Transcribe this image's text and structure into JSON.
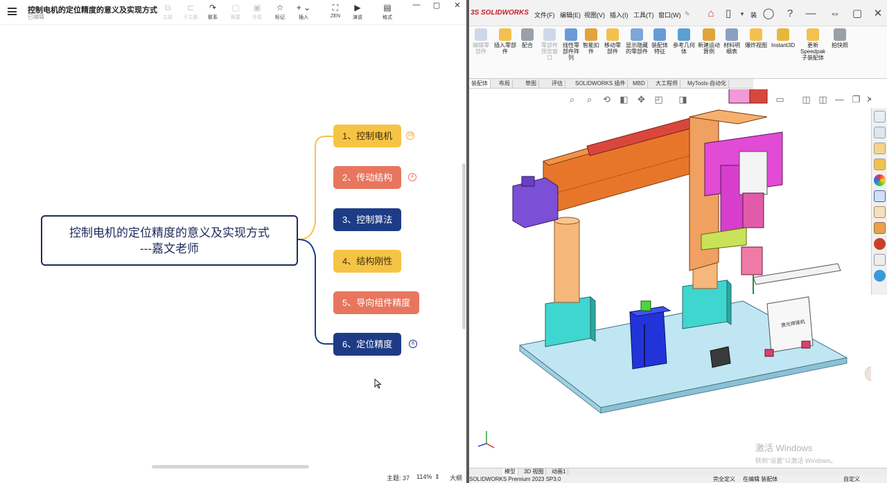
{
  "mindmap": {
    "title": "控制电机的定位精度的意义及实现方式",
    "subtitle": "已编辑",
    "toolbar": [
      {
        "icon": "⧉",
        "label": "主题",
        "disabled": true
      },
      {
        "icon": "⊏",
        "label": "子主题",
        "disabled": true
      },
      {
        "icon": "↷",
        "label": "联系",
        "disabled": false
      },
      {
        "icon": "▢",
        "label": "概要",
        "disabled": true
      },
      {
        "icon": "▣",
        "label": "外框",
        "disabled": true
      },
      {
        "icon": "☆",
        "label": "标记",
        "disabled": false
      },
      {
        "icon": "+ ⌄",
        "label": "插入",
        "disabled": false
      },
      {
        "icon": "⛶",
        "label": "ZEN",
        "disabled": false
      },
      {
        "icon": "▶",
        "label": "演说",
        "disabled": false
      },
      {
        "icon": "▤",
        "label": "格式",
        "disabled": false
      }
    ],
    "window_controls": [
      "—",
      "▢",
      "✕"
    ],
    "central_topic": {
      "line1": "控制电机的定位精度的意义及实现方式",
      "line2": "---嘉文老师"
    },
    "topics": [
      {
        "label": "1、控制电机",
        "color": "yellow",
        "badge": "19"
      },
      {
        "label": "2、传动结构",
        "color": "salmon",
        "badge": "4"
      },
      {
        "label": "3、控制算法",
        "color": "navy",
        "badge": ""
      },
      {
        "label": "4、结构刚性",
        "color": "yellow",
        "badge": ""
      },
      {
        "label": "5、导向组件精度",
        "color": "salmon",
        "badge": ""
      },
      {
        "label": "6、定位精度",
        "color": "navy",
        "badge": "8"
      }
    ],
    "status": {
      "topic_count": "主题: 37",
      "zoom": "114%",
      "outline": "大纲"
    }
  },
  "solidworks": {
    "logo": "3S SOLIDWORKS",
    "menu": [
      "文件(F)",
      "编辑(E)",
      "视图(V)",
      "插入(I)",
      "工具(T)",
      "窗口(W)"
    ],
    "doc_label": "装",
    "ribbon": [
      {
        "label": "编辑零部件",
        "disabled": true,
        "color": "#cfd8e8"
      },
      {
        "label": "插入零部件",
        "disabled": false,
        "color": "#f2c14e"
      },
      {
        "label": "配合",
        "disabled": false,
        "color": "#9aa0a8"
      },
      {
        "label": "零部件预览窗口",
        "disabled": true,
        "color": "#cfd8e8"
      },
      {
        "label": "线性零部件阵列",
        "disabled": false,
        "color": "#6a9bd8"
      },
      {
        "label": "智能扣件",
        "disabled": false,
        "color": "#e0a43c"
      },
      {
        "label": "移动零部件",
        "disabled": false,
        "color": "#f2c14e"
      },
      {
        "label": "显示隐藏的零部件",
        "disabled": false,
        "color": "#7da7d9"
      },
      {
        "label": "装配体特征",
        "disabled": false,
        "color": "#6a9bd8"
      },
      {
        "label": "参考几何体",
        "disabled": false,
        "color": "#5aa0d0"
      },
      {
        "label": "新建运动算例",
        "disabled": false,
        "color": "#e0a43c"
      },
      {
        "label": "材料明细表",
        "disabled": false,
        "color": "#8aa0c0"
      },
      {
        "label": "爆炸视图",
        "disabled": false,
        "color": "#f2c14e"
      },
      {
        "label": "Instant3D",
        "disabled": false,
        "color": "#e6b83a"
      },
      {
        "label": "更新Speedpak子装配体",
        "disabled": false,
        "color": "#f2c14e"
      },
      {
        "label": "拍快照",
        "disabled": false,
        "color": "#9aa0a8"
      }
    ],
    "tabs": [
      "装配体",
      "布局",
      "草图",
      "评估",
      "SOLIDWORKS 插件",
      "MBD",
      "大工程师",
      "MyTools-自动化"
    ],
    "bottom_tabs": [
      "模型",
      "3D 视图",
      "动画1"
    ],
    "status": {
      "left": "SOLIDWORKS Premium 2023 SP3.0",
      "s1": "完全定义",
      "s2": "在编辑 装配体",
      "s3": "自定义"
    },
    "watermark": {
      "line1": "激活 Windows",
      "line2": "转到\"设置\"以激活 Windows。"
    },
    "fixture_label": "激光焊接机"
  }
}
